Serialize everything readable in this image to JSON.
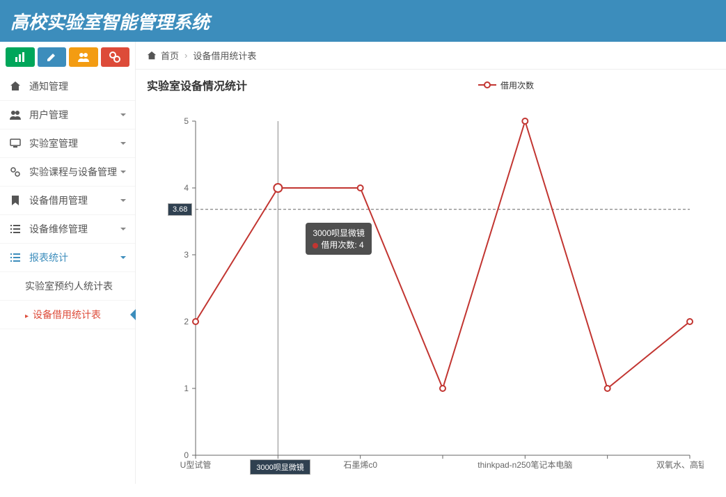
{
  "header": {
    "title": "高校实验室智能管理系统"
  },
  "breadcrumb": {
    "home": "首页",
    "current": "设备借用统计表"
  },
  "sidebar": {
    "items": [
      {
        "label": "通知管理",
        "expandable": false
      },
      {
        "label": "用户管理",
        "expandable": true
      },
      {
        "label": "实验室管理",
        "expandable": true
      },
      {
        "label": "实验课程与设备管理",
        "expandable": true
      },
      {
        "label": "设备借用管理",
        "expandable": true
      },
      {
        "label": "设备维修管理",
        "expandable": true
      },
      {
        "label": "报表统计",
        "expandable": true,
        "active": true
      }
    ],
    "sub": [
      {
        "label": "实验室预约人统计表"
      },
      {
        "label": "设备借用统计表",
        "active": true
      }
    ]
  },
  "chart_data": {
    "type": "line",
    "title": "实验室设备情况统计",
    "legend": {
      "series_name": "借用次数"
    },
    "xlabel": "",
    "ylabel": "",
    "ylim": [
      0,
      5
    ],
    "yticks": [
      0,
      1,
      2,
      3,
      4,
      5
    ],
    "categories": [
      "U型试管",
      "3000呗显微镜",
      "石墨烯c0",
      "",
      "thinkpad-n250笔记本电脑",
      "",
      "双氧水、高锰酸钾"
    ],
    "values": [
      2,
      4,
      4,
      1,
      5,
      1,
      2
    ],
    "average_marker": 3.68,
    "highlight_index": 1,
    "tooltip": {
      "category": "3000呗显微镜",
      "series": "借用次数",
      "value": 4
    },
    "colors": {
      "line": "#c23531",
      "point_fill": "#ffffff"
    }
  }
}
